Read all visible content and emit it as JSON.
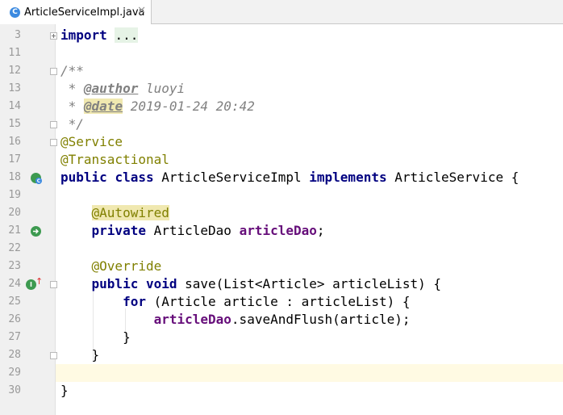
{
  "tab": {
    "icon_letter": "C",
    "filename": "ArticleServiceImpl.java",
    "close_glyph": "✕"
  },
  "gutter_icons": {
    "class_impl": "C",
    "overrides": "I"
  },
  "lines": [
    {
      "num": "3",
      "segments": [
        {
          "t": "import",
          "c": "kw"
        },
        {
          "t": " "
        },
        {
          "t": "...",
          "c": "fold-ph"
        }
      ]
    },
    {
      "num": "11",
      "segments": []
    },
    {
      "num": "12",
      "segments": [
        {
          "t": "/**",
          "c": "cm"
        }
      ]
    },
    {
      "num": "13",
      "segments": [
        {
          "t": " * ",
          "c": "cm"
        },
        {
          "t": "@author",
          "c": "doc-tag"
        },
        {
          "t": " luoyi",
          "c": "cm"
        }
      ]
    },
    {
      "num": "14",
      "segments": [
        {
          "t": " * ",
          "c": "cm"
        },
        {
          "t": "@date",
          "c": "doc-tag ann-hl"
        },
        {
          "t": " 2019-01-24 20:42",
          "c": "cm"
        }
      ]
    },
    {
      "num": "15",
      "segments": [
        {
          "t": " */",
          "c": "cm"
        }
      ]
    },
    {
      "num": "16",
      "segments": [
        {
          "t": "@Service",
          "c": "ann"
        }
      ]
    },
    {
      "num": "17",
      "segments": [
        {
          "t": "@Transactional",
          "c": "ann"
        }
      ]
    },
    {
      "num": "18",
      "segments": [
        {
          "t": "public",
          "c": "kw"
        },
        {
          "t": " "
        },
        {
          "t": "class",
          "c": "kw"
        },
        {
          "t": " ArticleServiceImpl "
        },
        {
          "t": "implements",
          "c": "kw"
        },
        {
          "t": " ArticleService {"
        }
      ]
    },
    {
      "num": "19",
      "segments": []
    },
    {
      "num": "20",
      "segments": [
        {
          "t": "    "
        },
        {
          "t": "@Autowired",
          "c": "ann ann-hl"
        }
      ]
    },
    {
      "num": "21",
      "segments": [
        {
          "t": "    "
        },
        {
          "t": "private",
          "c": "kw"
        },
        {
          "t": " ArticleDao "
        },
        {
          "t": "articleDao",
          "c": "field"
        },
        {
          "t": ";"
        }
      ]
    },
    {
      "num": "22",
      "segments": []
    },
    {
      "num": "23",
      "segments": [
        {
          "t": "    "
        },
        {
          "t": "@Override",
          "c": "ann"
        }
      ]
    },
    {
      "num": "24",
      "segments": [
        {
          "t": "    "
        },
        {
          "t": "public",
          "c": "kw"
        },
        {
          "t": " "
        },
        {
          "t": "void",
          "c": "kw"
        },
        {
          "t": " save(List<Article> articleList) {"
        }
      ]
    },
    {
      "num": "25",
      "segments": [
        {
          "t": "        "
        },
        {
          "t": "for",
          "c": "kw"
        },
        {
          "t": " (Article article : articleList) {"
        }
      ]
    },
    {
      "num": "26",
      "segments": [
        {
          "t": "            "
        },
        {
          "t": "articleDao",
          "c": "field"
        },
        {
          "t": ".saveAndFlush(article);"
        }
      ]
    },
    {
      "num": "27",
      "segments": [
        {
          "t": "        }"
        }
      ]
    },
    {
      "num": "28",
      "segments": [
        {
          "t": "    }"
        }
      ]
    },
    {
      "num": "29",
      "segments": []
    },
    {
      "num": "30",
      "segments": [
        {
          "t": "}"
        }
      ]
    }
  ]
}
